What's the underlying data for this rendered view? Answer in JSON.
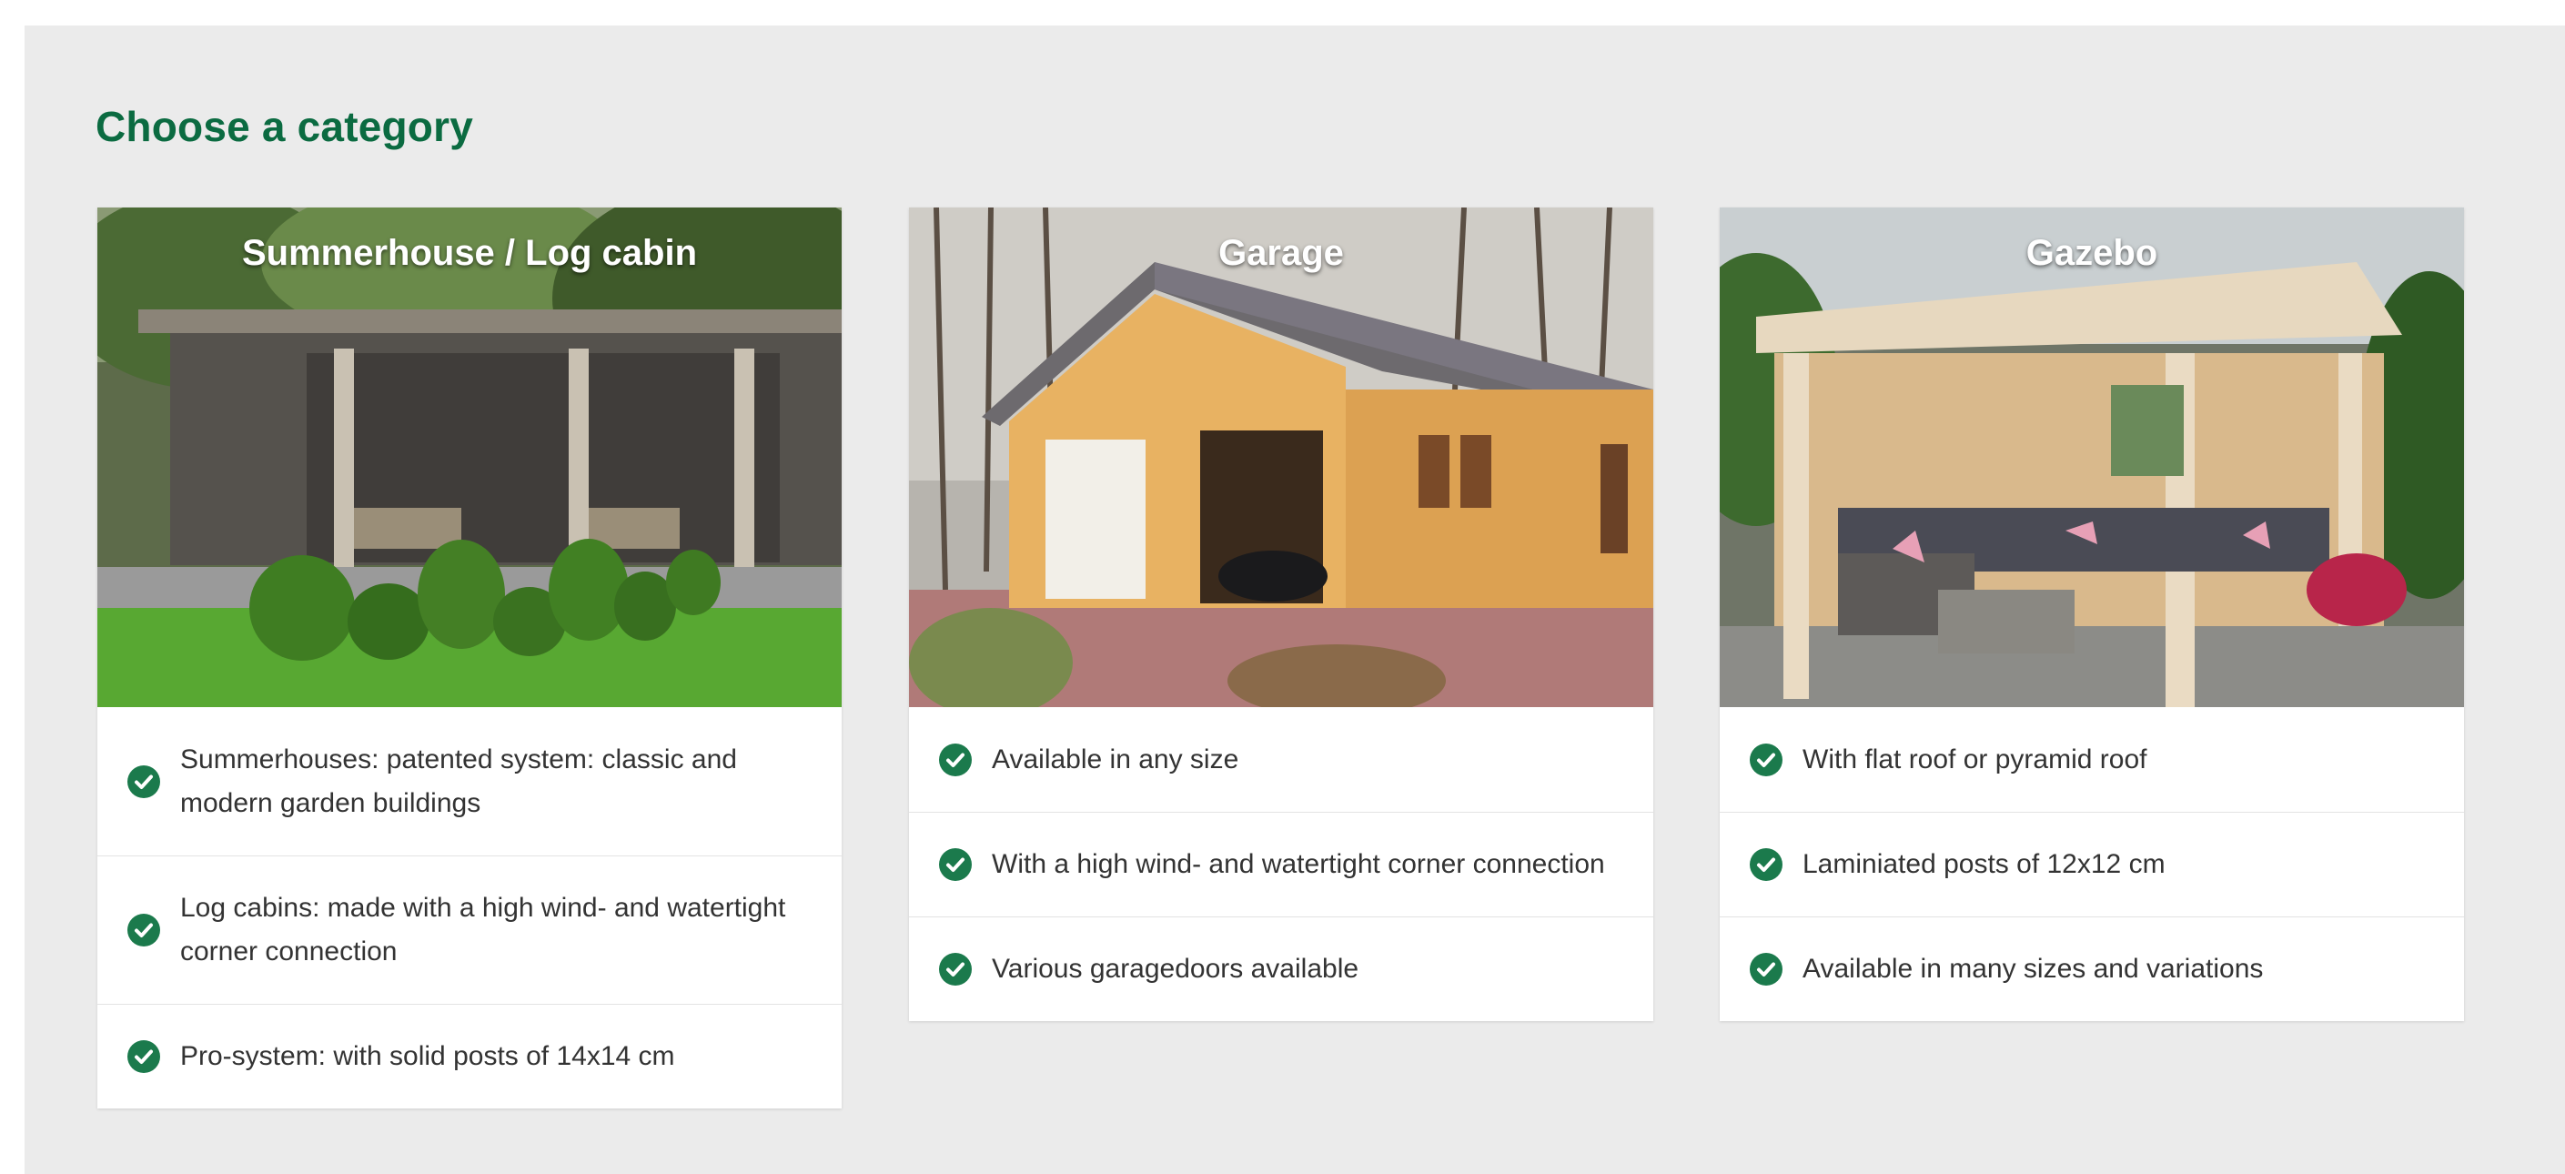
{
  "section": {
    "heading": "Choose a category"
  },
  "colors": {
    "accent": "#0b6b41",
    "check": "#1b7a4c",
    "panel_background": "#ebebeb"
  },
  "cards": [
    {
      "title": "Summerhouse / Log cabin",
      "image": "summerhouse-photo",
      "features": [
        "Summerhouses: patented system: classic and modern garden buildings",
        "Log cabins: made with a high wind- and watertight corner connection",
        "Pro-system: with solid posts of 14x14 cm"
      ]
    },
    {
      "title": "Garage",
      "image": "garage-photo",
      "features": [
        "Available in any size",
        "With a high wind- and watertight corner connection",
        "Various garagedoors available"
      ]
    },
    {
      "title": "Gazebo",
      "image": "gazebo-photo",
      "features": [
        "With flat roof or pyramid roof",
        "Laminiated posts of 12x12 cm",
        "Available in many sizes and variations"
      ]
    }
  ],
  "icons": {
    "feature_bullet": "check-circle-icon"
  }
}
